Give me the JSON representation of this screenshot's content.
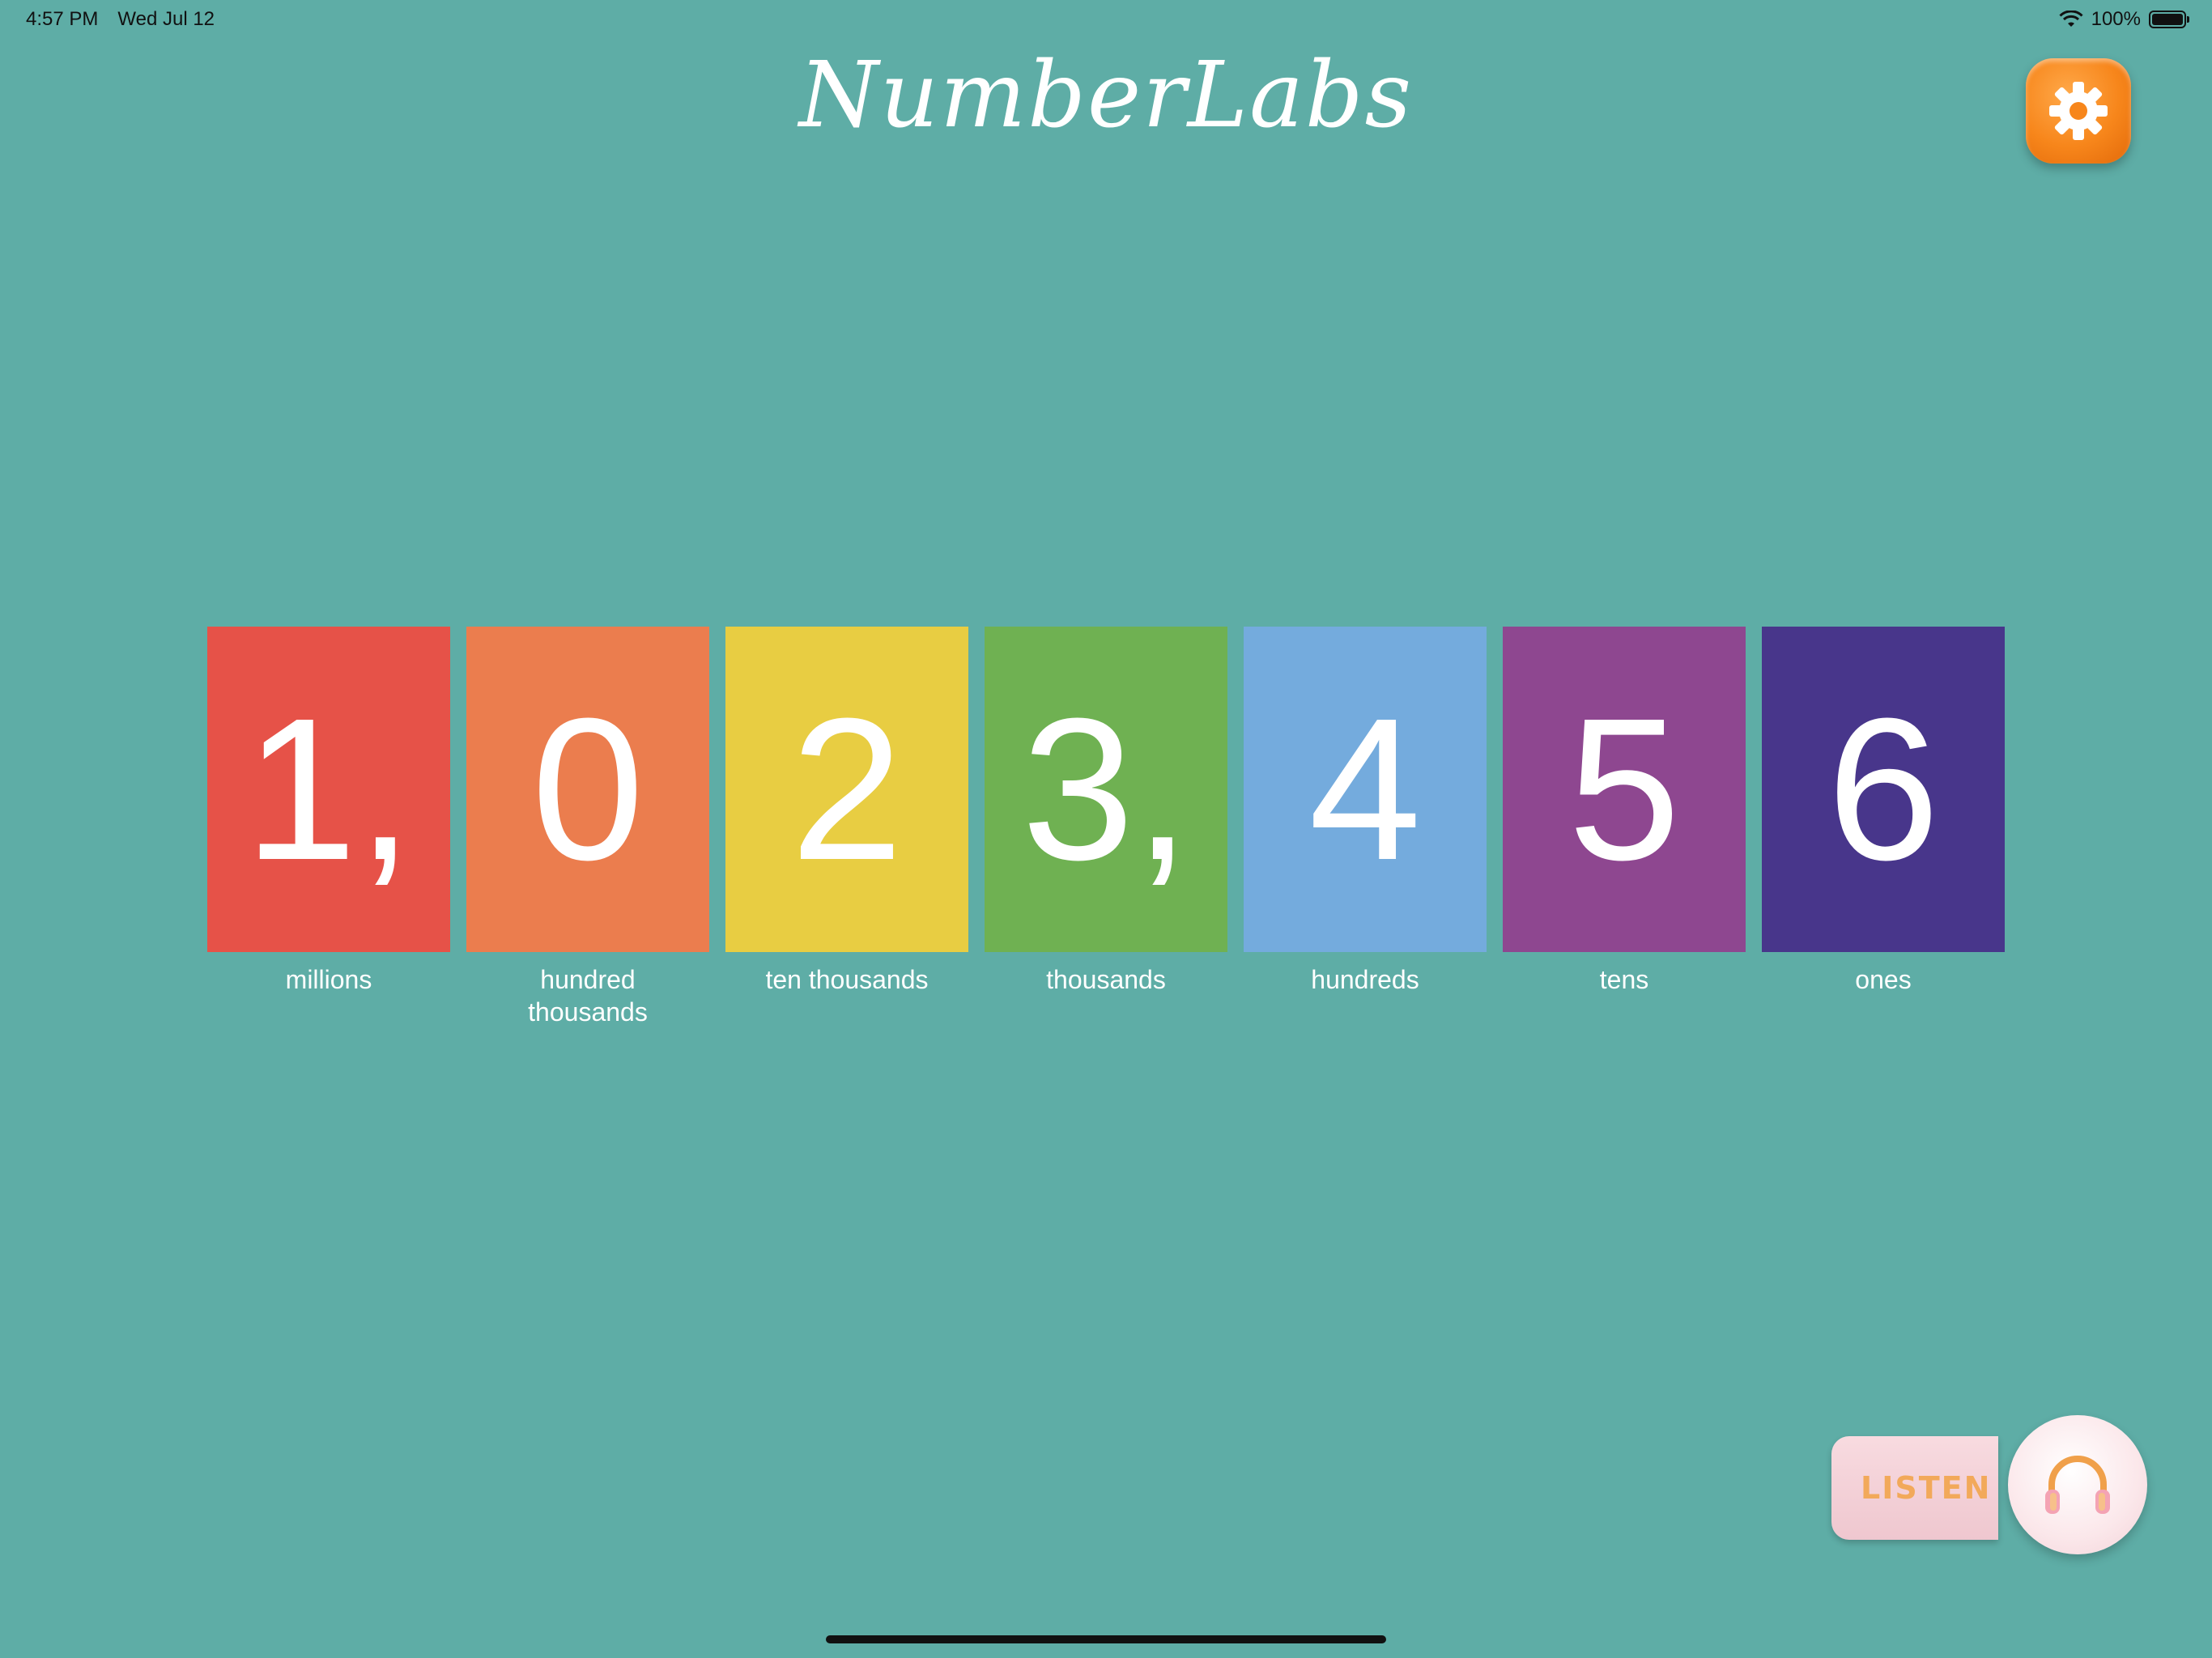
{
  "status_bar": {
    "time": "4:57 PM",
    "date": "Wed Jul 12",
    "battery": "100%"
  },
  "header": {
    "title": "NumberLabs"
  },
  "settings": {
    "icon": "gear-icon",
    "color": "#f7861b"
  },
  "tiles": [
    {
      "digit": "1,",
      "label": "millions",
      "color": "#e65248"
    },
    {
      "digit": "0",
      "label": "hundred thousands",
      "color": "#eb7d4e"
    },
    {
      "digit": "2",
      "label": "ten thousands",
      "color": "#e8cd42"
    },
    {
      "digit": "3,",
      "label": "thousands",
      "color": "#6fb152"
    },
    {
      "digit": "4",
      "label": "hundreds",
      "color": "#74abdd"
    },
    {
      "digit": "5",
      "label": "tens",
      "color": "#8e4790"
    },
    {
      "digit": "6",
      "label": "ones",
      "color": "#48368b"
    }
  ],
  "listen": {
    "label": "LISTEN",
    "icon": "headphones-icon"
  }
}
